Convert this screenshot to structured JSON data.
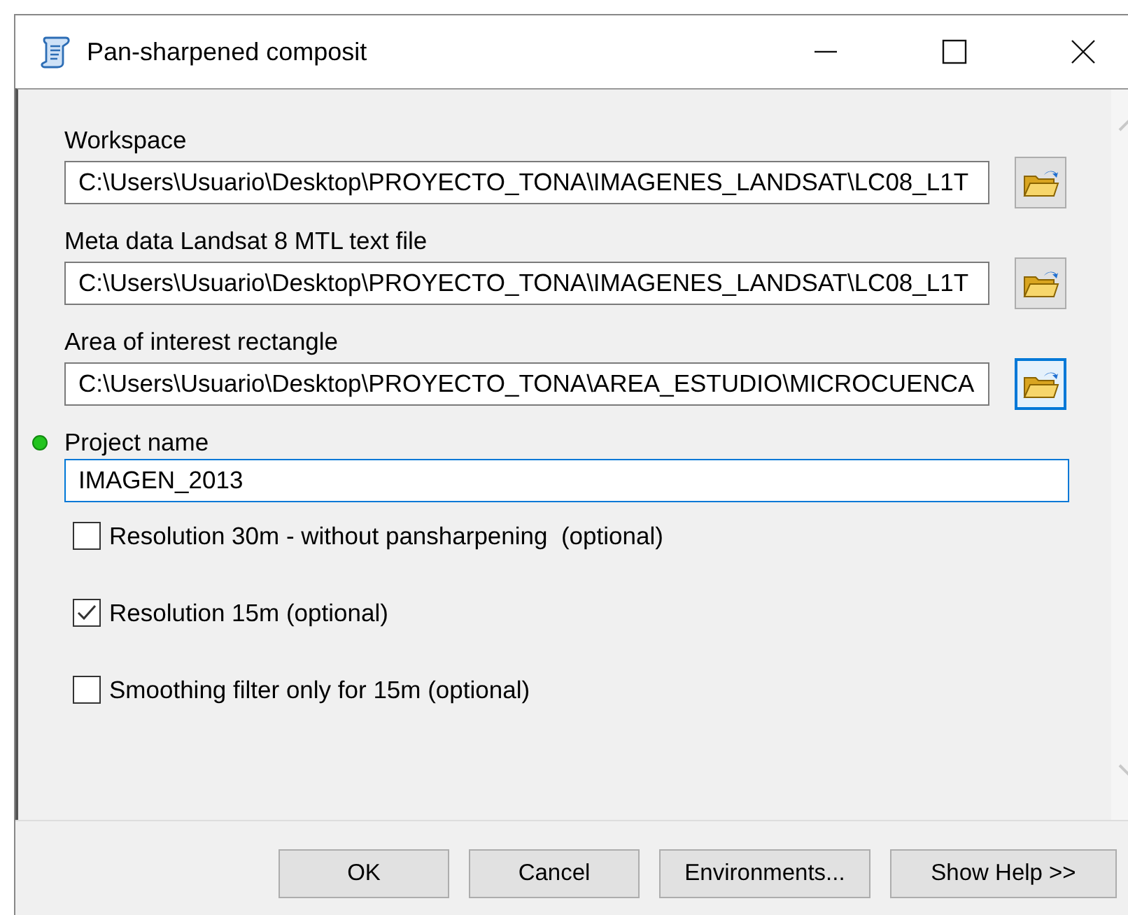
{
  "window": {
    "title": "Pan-sharpened composit"
  },
  "parameters": [
    {
      "label": "Workspace",
      "value": "C:\\Users\\Usuario\\Desktop\\PROYECTO_TONA\\IMAGENES_LANDSAT\\LC08_L1T",
      "required": false,
      "focused": false,
      "browse": {
        "focused": false
      }
    },
    {
      "label": "Meta data Landsat 8 MTL text file",
      "value": "C:\\Users\\Usuario\\Desktop\\PROYECTO_TONA\\IMAGENES_LANDSAT\\LC08_L1T",
      "required": false,
      "focused": false,
      "browse": {
        "focused": false
      }
    },
    {
      "label": "Area of interest rectangle",
      "value": "C:\\Users\\Usuario\\Desktop\\PROYECTO_TONA\\AREA_ESTUDIO\\MICROCUENCA",
      "required": false,
      "focused": false,
      "browse": {
        "focused": true
      }
    },
    {
      "label": "Project name",
      "value": "IMAGEN_2013",
      "required": true,
      "focused": true
    }
  ],
  "options": [
    {
      "label": "Resolution 30m - without pansharpening  (optional)",
      "checked": false
    },
    {
      "label": "Resolution 15m (optional)",
      "checked": true
    },
    {
      "label": "Smoothing filter only for 15m (optional)",
      "checked": false
    }
  ],
  "buttons": [
    "OK",
    "Cancel",
    "Environments...",
    "Show Help >>"
  ]
}
